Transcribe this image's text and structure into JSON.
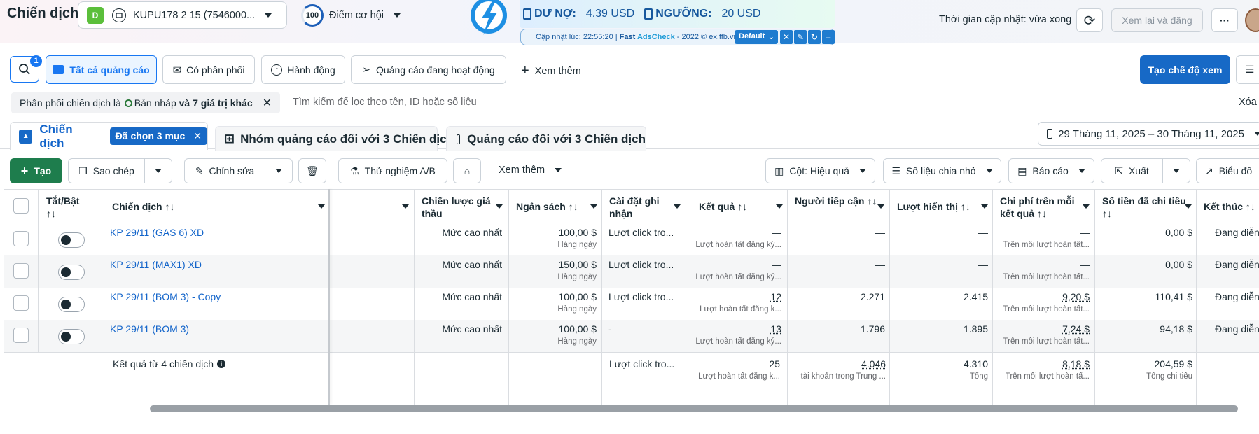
{
  "header": {
    "title": "Chiến dịch",
    "account_letter": "D",
    "account_name": "KUPU178 2 15 (7546000...",
    "score": "100",
    "score_label": "Điểm cơ hội",
    "update_time": "Thời gian cập nhật: vừa xong",
    "review_btn": "Xem lại và đăng"
  },
  "ext": {
    "debt_label": "DƯ NỢ:",
    "debt_value": "4.39 USD",
    "threshold_label": "NGƯỠNG:",
    "threshold_value": "20 USD",
    "updated": "Cập nhật lúc: 22:55:20 | ",
    "brand_fast": "Fast ",
    "brand_ads": "AdsCheck",
    "brand_rest": " - 2022 © ex.ffb.vn",
    "mode": "Default"
  },
  "toolbar": {
    "search_badge": "1",
    "all_ads": "Tất cả quảng cáo",
    "has_delivery": "Có phân phối",
    "actions": "Hành động",
    "active_ads": "Quảng cáo đang hoạt động",
    "see_more": "Xem thêm",
    "create_view": "Tạo chế độ xem"
  },
  "filter": {
    "chip_prefix": "Phân phối chiến dịch là",
    "chip_draft": "Bản nháp",
    "chip_more": "và 7 giá trị khác",
    "placeholder": "Tìm kiếm để lọc theo tên, ID hoặc số liệu",
    "clear": "Xóa"
  },
  "tabs": {
    "campaigns": "Chiến dịch",
    "selected": "Đã chọn 3 mục",
    "adsets": "Nhóm quảng cáo đối với 3 Chiến dịch",
    "ads": "Quảng cáo đối với 3 Chiến dịch",
    "date_range": "29 Tháng 11, 2025 – 30 Tháng 11, 2025"
  },
  "actions": {
    "create": "Tạo",
    "duplicate": "Sao chép",
    "edit": "Chỉnh sửa",
    "ab_test": "Thử nghiệm A/B",
    "see_more": "Xem thêm",
    "columns": "Cột: Hiệu quả",
    "breakdown": "Số liệu chia nhỏ",
    "reports": "Báo cáo",
    "export": "Xuất",
    "chart": "Biểu đồ"
  },
  "columns": {
    "onoff": "Tắt/Bật",
    "onoff_sort": "↑↓",
    "campaign": "Chiến dịch ↑↓",
    "bid": "Chiến lược giá thầu",
    "budget": "Ngân sách ↑↓",
    "attribution": "Cài đặt ghi nhận",
    "results": "Kết quả ↑↓",
    "reach": "Người tiếp cận ↑↓",
    "impressions": "Lượt hiển thị ↑↓",
    "cpr": "Chi phí trên mỗi kết quả ↑↓",
    "spent": "Số tiền đã chi tiêu ↑↓",
    "ends": "Kết thúc ↑↓"
  },
  "rows": [
    {
      "name": "KP 29/11 (GAS 6) XD",
      "bid": "Mức cao nhất",
      "budget": "100,00 $",
      "budget_sub": "Hàng ngày",
      "attribution": "Lượt click tro...",
      "results": "—",
      "results_sub": "Lượt hoàn tất đăng ký...",
      "reach": "—",
      "impressions": "—",
      "cpr": "—",
      "cpr_sub": "Trên mỗi lượt hoàn tất...",
      "spent": "0,00 $",
      "ends": "Đang diễn"
    },
    {
      "name": "KP 29/11 (MAX1) XD",
      "bid": "Mức cao nhất",
      "budget": "150,00 $",
      "budget_sub": "Hàng ngày",
      "attribution": "Lượt click tro...",
      "results": "—",
      "results_sub": "Lượt hoàn tất đăng ký...",
      "reach": "—",
      "impressions": "—",
      "cpr": "—",
      "cpr_sub": "Trên mỗi lượt hoàn tất...",
      "spent": "0,00 $",
      "ends": "Đang diễn"
    },
    {
      "name": "KP 29/11 (BOM 3) - Copy",
      "bid": "Mức cao nhất",
      "budget": "100,00 $",
      "budget_sub": "Hàng ngày",
      "attribution": "Lượt click tro...",
      "results": "12",
      "results_sub": "Lượt hoàn tất đăng k...",
      "reach": "2.271",
      "impressions": "2.415",
      "cpr": "9,20 $",
      "cpr_sub": "Trên mỗi lượt hoàn tất...",
      "spent": "110,41 $",
      "ends": "Đang diễn"
    },
    {
      "name": "KP 29/11 (BOM 3)",
      "bid": "Mức cao nhất",
      "budget": "100,00 $",
      "budget_sub": "Hàng ngày",
      "attribution": "-",
      "results": "13",
      "results_sub": "Lượt hoàn tất đăng ký...",
      "reach": "1.796",
      "impressions": "1.895",
      "cpr": "7,24 $",
      "cpr_sub": "Trên mỗi lượt hoàn tất...",
      "spent": "94,18 $",
      "ends": "Đang diễn"
    }
  ],
  "totals": {
    "label": "Kết quả từ 4 chiến dịch",
    "attribution": "Lượt click tro...",
    "results": "25",
    "results_sub": "Lượt hoàn tất đăng k...",
    "reach": "4.046",
    "reach_sub": "tài khoản trong Trung ...",
    "impressions": "4.310",
    "impressions_sub": "Tổng",
    "cpr": "8,18 $",
    "cpr_sub": "Trên mỗi lượt hoàn tấ...",
    "spent": "204,59 $",
    "spent_sub": "Tổng chi tiêu"
  }
}
